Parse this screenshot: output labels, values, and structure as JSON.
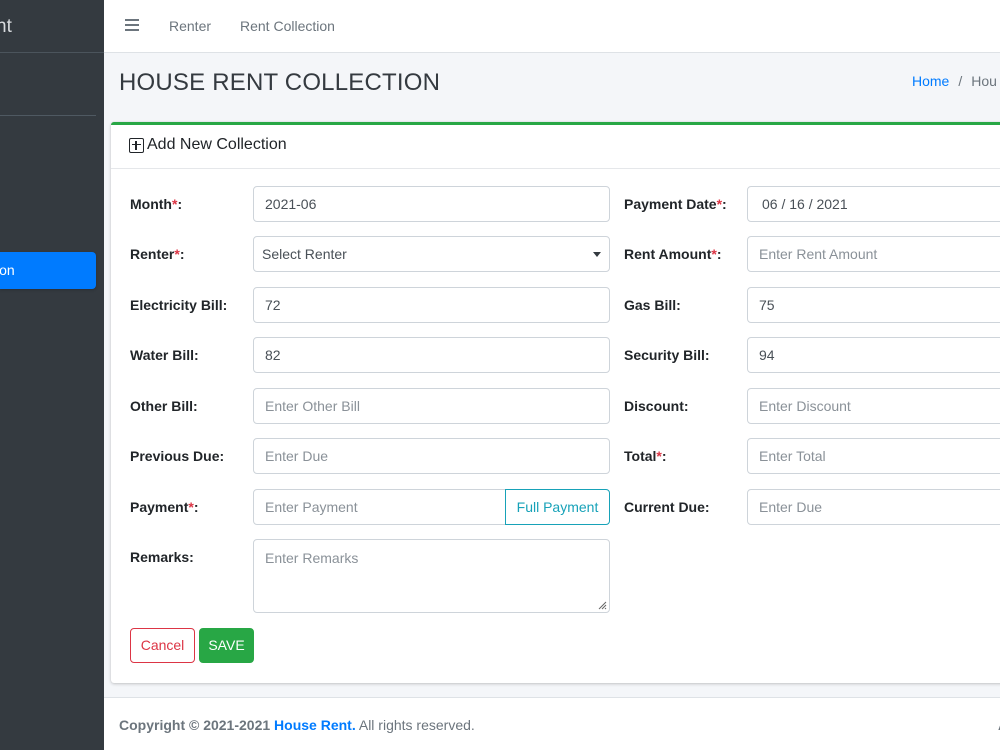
{
  "sidebar": {
    "brand_text": "nt",
    "active_item_label": "ion"
  },
  "topnav": {
    "links": [
      "Renter",
      "Rent Collection"
    ]
  },
  "page": {
    "title": "HOUSE RENT COLLECTION",
    "breadcrumb": {
      "home": "Home",
      "separator": "/",
      "current": "Hou"
    }
  },
  "card": {
    "title": "Add New Collection"
  },
  "form": {
    "month": {
      "label": "Month",
      "required": "*",
      "colon": ":",
      "value": "2021-06"
    },
    "payment_date": {
      "label": "Payment Date",
      "required": "*",
      "colon": ":",
      "value": "06 / 16 / 2021"
    },
    "renter": {
      "label": "Renter",
      "required": "*",
      "colon": ":",
      "selected": "Select Renter"
    },
    "rent_amount": {
      "label": "Rent Amount",
      "required": "*",
      "colon": ":",
      "placeholder": "Enter Rent Amount"
    },
    "electricity_bill": {
      "label": "Electricity Bill:",
      "value": "72"
    },
    "gas_bill": {
      "label": "Gas Bill:",
      "value": "75"
    },
    "water_bill": {
      "label": "Water Bill:",
      "value": "82"
    },
    "security_bill": {
      "label": "Security Bill:",
      "value": "94"
    },
    "other_bill": {
      "label": "Other Bill:",
      "placeholder": "Enter Other Bill"
    },
    "discount": {
      "label": "Discount:",
      "placeholder": "Enter Discount"
    },
    "previous_due": {
      "label": "Previous Due:",
      "placeholder": "Enter Due"
    },
    "total": {
      "label": "Total",
      "required": "*",
      "colon": ":",
      "placeholder": "Enter Total"
    },
    "payment": {
      "label": "Payment",
      "required": "*",
      "colon": ":",
      "placeholder": "Enter Payment",
      "full_payment_label": "Full Payment"
    },
    "current_due": {
      "label": "Current Due:",
      "placeholder": "Enter Due"
    },
    "remarks": {
      "label": "Remarks:",
      "placeholder": "Enter Remarks"
    },
    "cancel_label": "Cancel",
    "save_label": "SAVE"
  },
  "footer": {
    "copyright": "Copyright © 2021-2021",
    "brand": "House Rent.",
    "rights": " All rights reserved.",
    "right_text": "A"
  },
  "colors": {
    "primary": "#007bff",
    "success": "#28a745",
    "danger": "#dc3545",
    "info": "#17a2b8",
    "sidebar_bg": "#343a40"
  }
}
